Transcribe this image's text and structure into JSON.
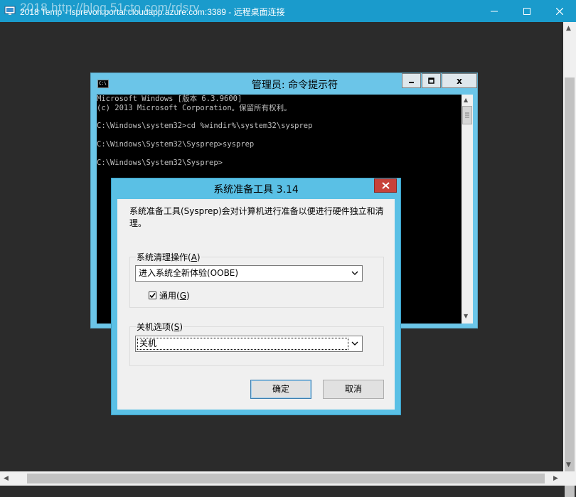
{
  "rdp": {
    "title": "2018 Temp - lsprevon.portal.cloudapp.azure.com:3389 - 远程桌面连接",
    "watermark": "2018 http://blog.51cto.com/rdsrv"
  },
  "cmd": {
    "title": "管理员: 命令提示符",
    "icon_label": "C:\\",
    "close_glyph": "x",
    "lines": [
      "Microsoft Windows [版本 6.3.9600]",
      "(c) 2013 Microsoft Corporation。保留所有权利。",
      "",
      "C:\\Windows\\system32>cd %windir%\\system32\\sysprep",
      "",
      "C:\\Windows\\System32\\Sysprep>sysprep",
      "",
      "C:\\Windows\\System32\\Sysprep>"
    ]
  },
  "dialog": {
    "title": "系统准备工具 3.14",
    "description": "系统准备工具(Sysprep)会对计算机进行准备以便进行硬件独立和清理。",
    "cleanup_group": {
      "label": "系统清理操作",
      "accel": "A"
    },
    "cleanup_value": "进入系统全新体验(OOBE)",
    "generalize": {
      "label": "通用",
      "accel": "G",
      "checked": true
    },
    "shutdown_group": {
      "label": "关机选项",
      "accel": "S"
    },
    "shutdown_value": "关机",
    "ok_label": "确定",
    "cancel_label": "取消"
  },
  "colors": {
    "rdp_titlebar": "#1a9bcc",
    "window_frame": "#6bc5e8",
    "dialog_frame": "#5ac0e5",
    "close_red": "#c7423a"
  }
}
